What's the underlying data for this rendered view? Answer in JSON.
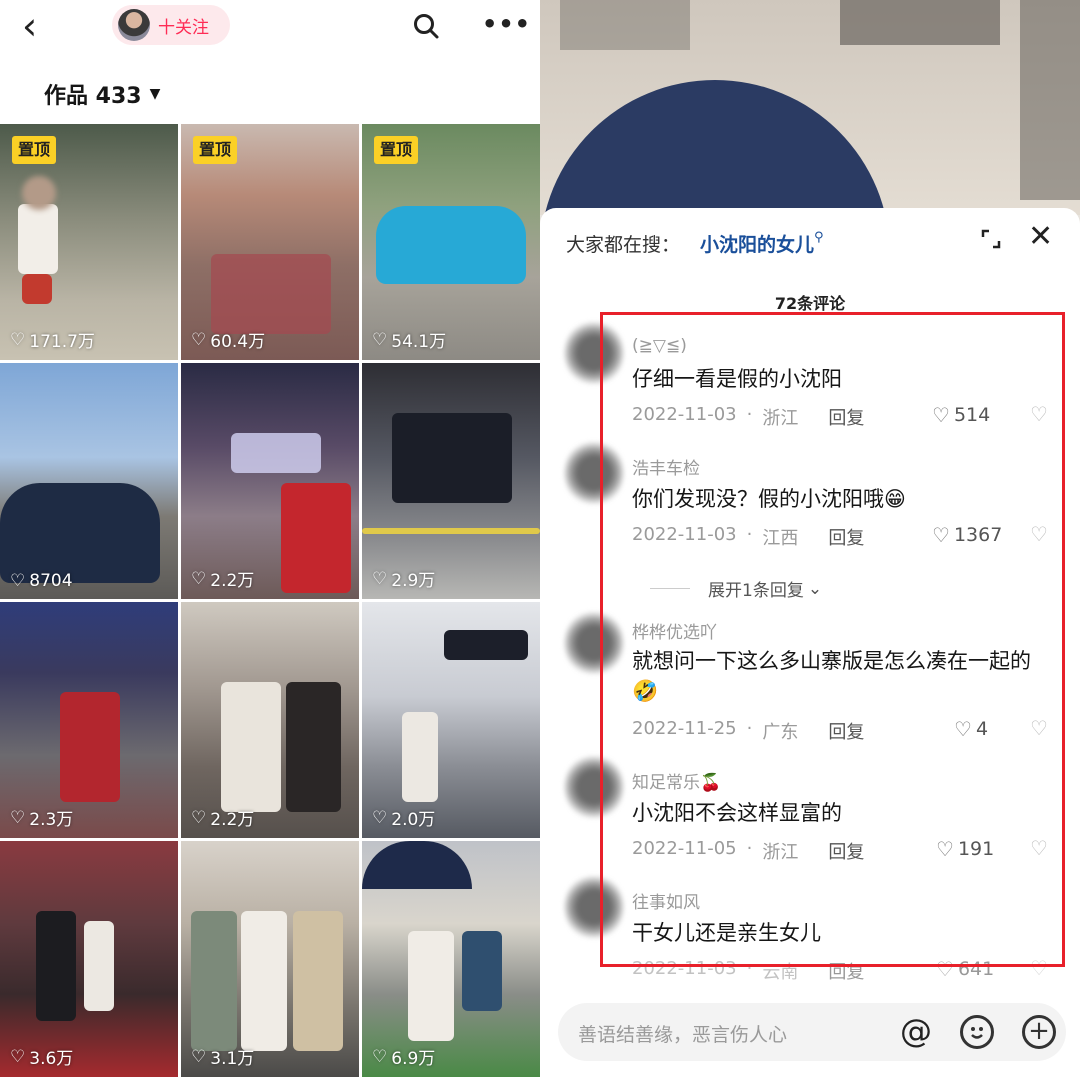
{
  "profile": {
    "back_icon": "chevron-left-icon",
    "follow_label": "十关注",
    "search_icon": "search-icon",
    "more_icon": "more-icon",
    "works_label": "作品 433"
  },
  "videos": [
    {
      "pinned": "置顶",
      "likes": "171.7万"
    },
    {
      "pinned": "置顶",
      "likes": "60.4万"
    },
    {
      "pinned": "置顶",
      "likes": "54.1万"
    },
    {
      "pinned": "",
      "likes": "8704"
    },
    {
      "pinned": "",
      "likes": "2.2万"
    },
    {
      "pinned": "",
      "likes": "2.9万"
    },
    {
      "pinned": "",
      "likes": "2.3万"
    },
    {
      "pinned": "",
      "likes": "2.2万"
    },
    {
      "pinned": "",
      "likes": "2.0万"
    },
    {
      "pinned": "",
      "likes": "3.6万"
    },
    {
      "pinned": "",
      "likes": "3.1万"
    },
    {
      "pinned": "",
      "likes": "6.9万"
    }
  ],
  "comments_panel": {
    "hot_search_label": "大家都在搜：",
    "hot_search_term": "小沈阳的女儿",
    "count_label": "72条评论",
    "reply_label": "回复",
    "expand_replies_label": "展开1条回复",
    "comments": [
      {
        "user": "(≧▽≦)",
        "text": "仔细一看是假的小沈阳",
        "date": "2022-11-03",
        "region": "浙江",
        "likes": "514"
      },
      {
        "user": "浩丰车检",
        "text": "你们发现没？假的小沈阳哦😁",
        "date": "2022-11-03",
        "region": "江西",
        "likes": "1367"
      },
      {
        "user": "桦桦优选吖",
        "text": "就想问一下这么多山寨版是怎么凑在一起的🤣",
        "date": "2022-11-25",
        "region": "广东",
        "likes": "4"
      },
      {
        "user": "知足常乐🍒",
        "text": "小沈阳不会这样显富的",
        "date": "2022-11-05",
        "region": "浙江",
        "likes": "191"
      },
      {
        "user": "往事如风",
        "text": "干女儿还是亲生女儿",
        "date": "2022-11-03",
        "region": "云南",
        "likes": "641"
      }
    ],
    "input_placeholder": "善语结善缘，恶言伤人心"
  }
}
